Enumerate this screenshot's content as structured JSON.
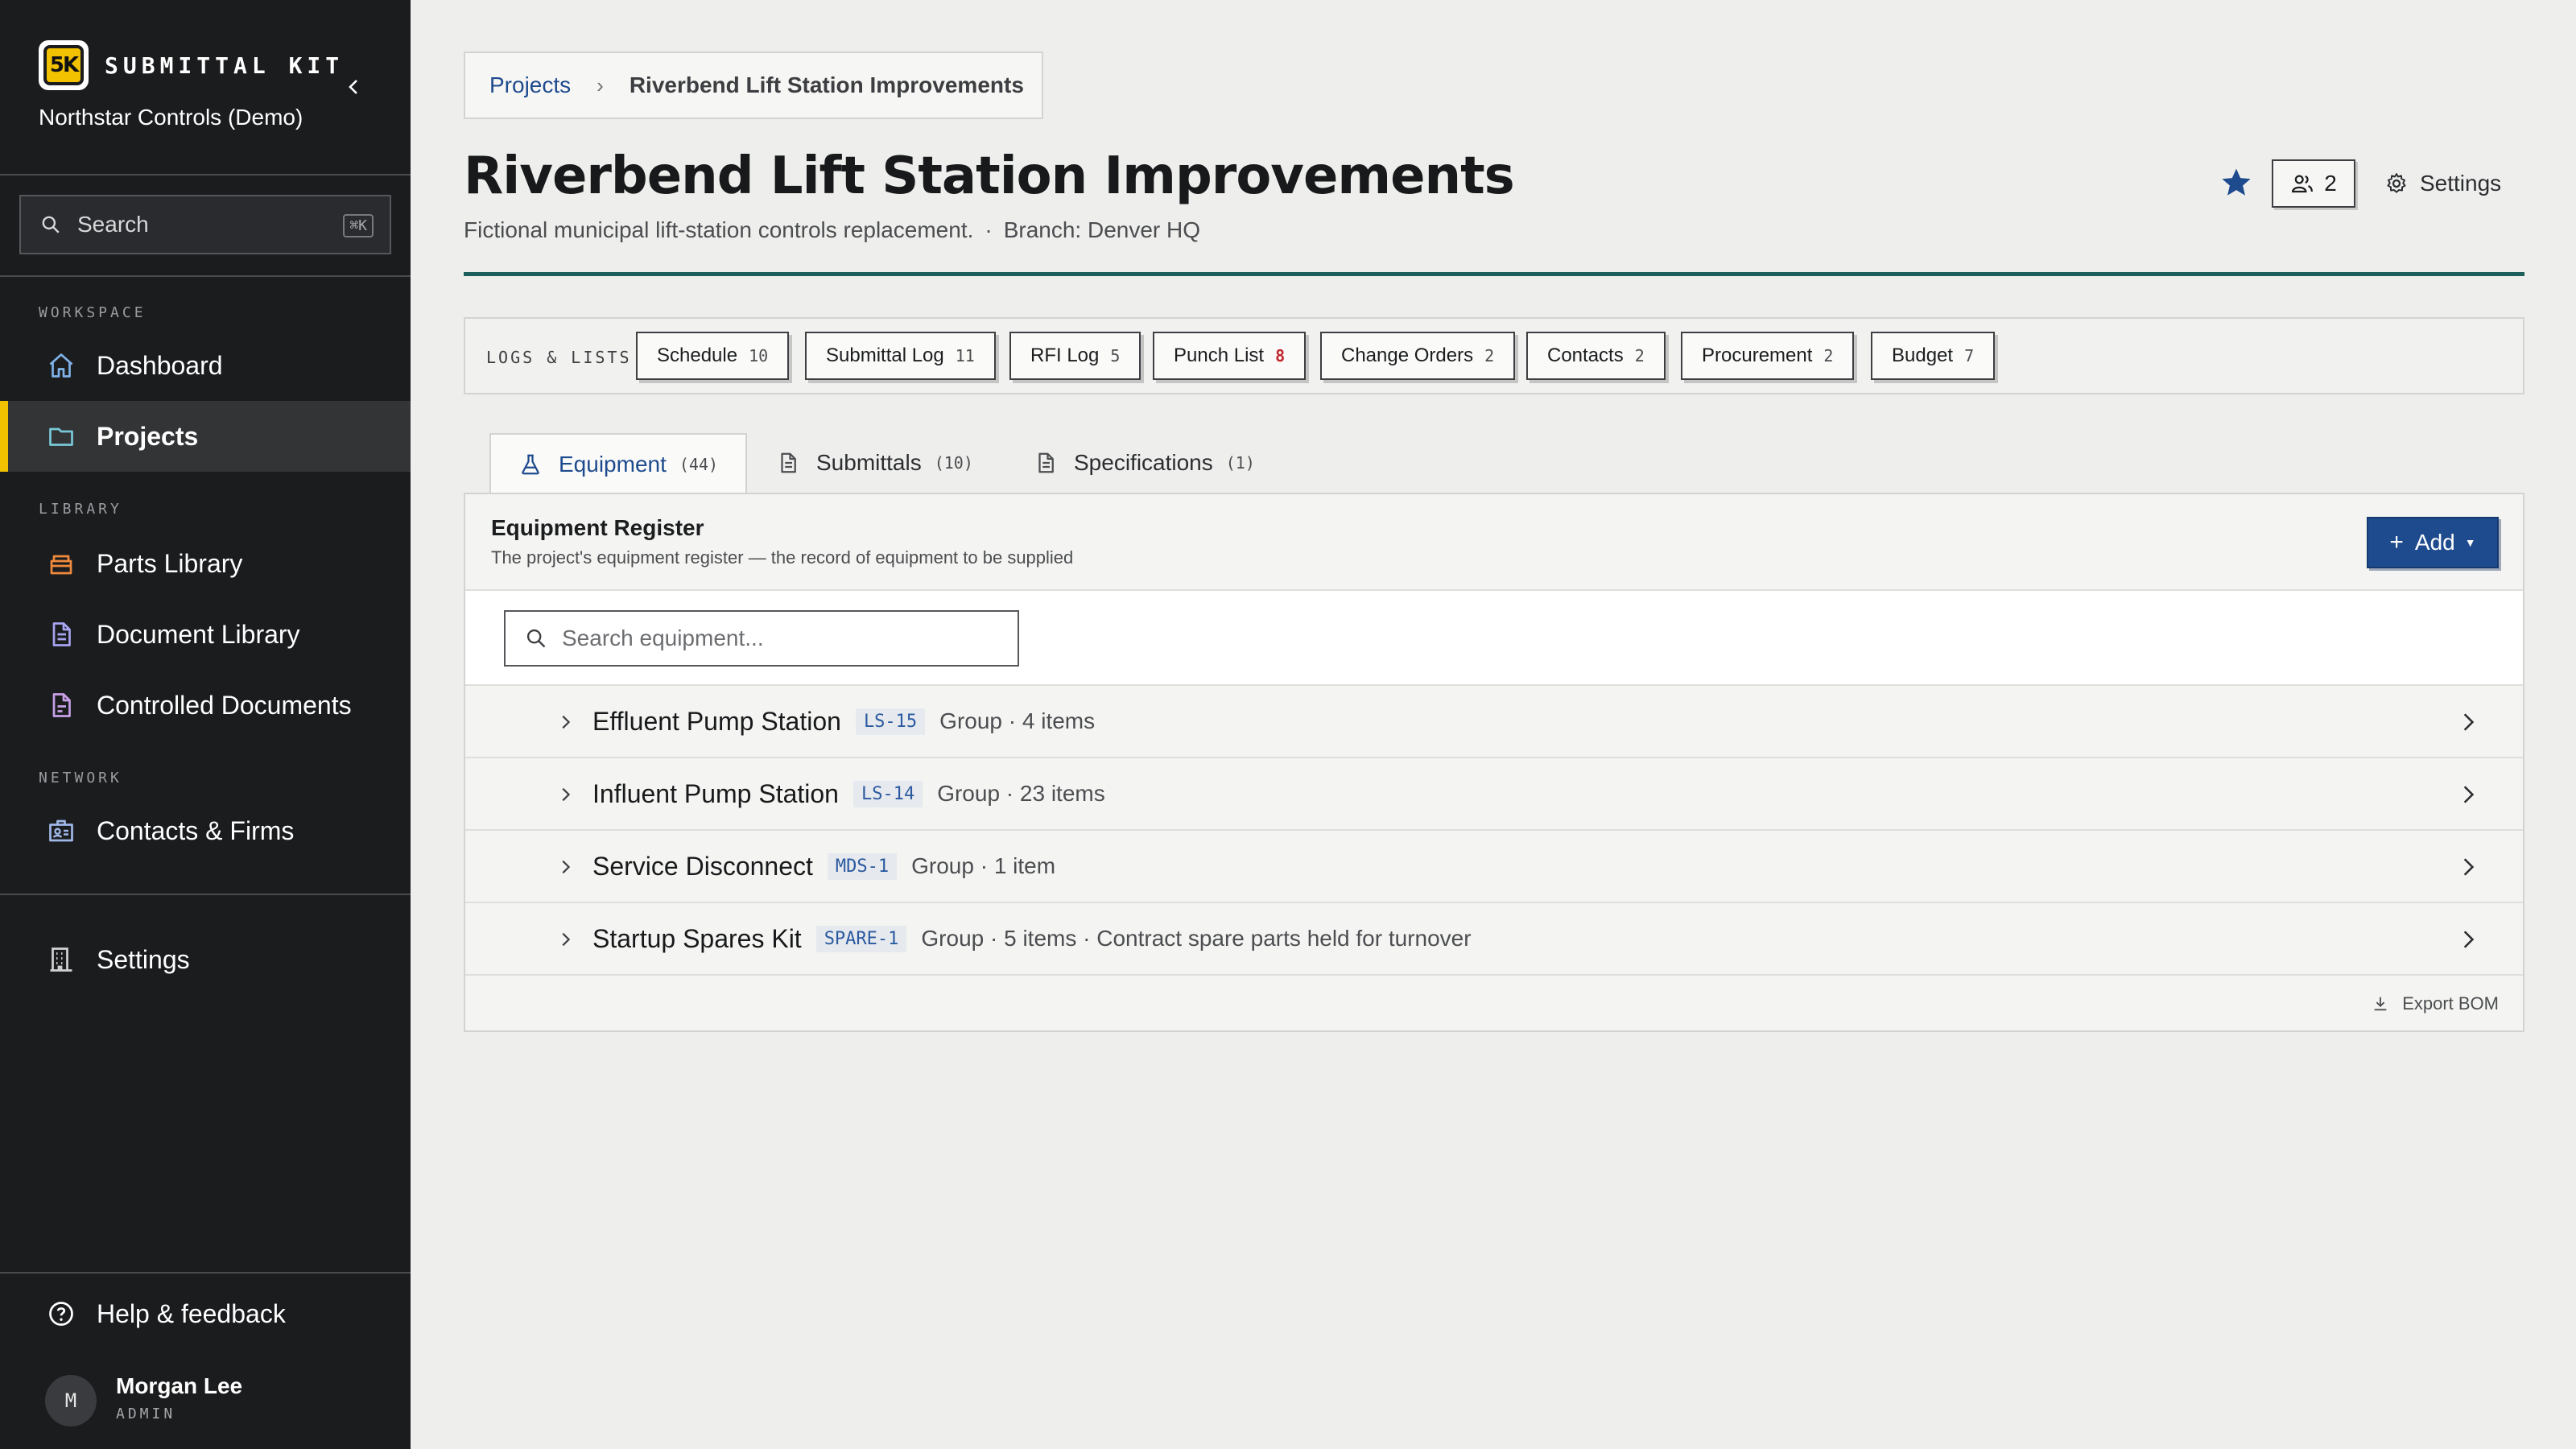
{
  "sidebar": {
    "brand_logo": "5K",
    "brand_name": "SUBMITTAL KIT",
    "org_name": "Northstar Controls (Demo)",
    "search_label": "Search",
    "search_shortcut": "⌘K",
    "section_workspace": "WORKSPACE",
    "section_library": "LIBRARY",
    "section_network": "NETWORK",
    "nav": {
      "dashboard": "Dashboard",
      "projects": "Projects",
      "parts_library": "Parts Library",
      "document_library": "Document Library",
      "controlled_documents": "Controlled Documents",
      "contacts_firms": "Contacts & Firms",
      "settings": "Settings",
      "help": "Help & feedback"
    },
    "user": {
      "initial": "M",
      "name": "Morgan Lee",
      "role": "ADMIN"
    },
    "accent_color": "#f2c200"
  },
  "breadcrumb": {
    "root": "Projects",
    "current": "Riverbend Lift Station Improvements"
  },
  "header": {
    "title": "Riverbend Lift Station Improvements",
    "description": "Fictional municipal lift-station controls replacement.",
    "separator": "·",
    "branch": "Branch: Denver HQ",
    "members_count": "2",
    "settings_label": "Settings",
    "starred": true
  },
  "logs": {
    "label": "LOGS & LISTS",
    "items": [
      {
        "label": "Schedule",
        "count": "10",
        "alert": false
      },
      {
        "label": "Submittal Log",
        "count": "11",
        "alert": false
      },
      {
        "label": "RFI Log",
        "count": "5",
        "alert": false
      },
      {
        "label": "Punch List",
        "count": "8",
        "alert": true
      },
      {
        "label": "Change Orders",
        "count": "2",
        "alert": false
      },
      {
        "label": "Contacts",
        "count": "2",
        "alert": false
      },
      {
        "label": "Procurement",
        "count": "2",
        "alert": false
      },
      {
        "label": "Budget",
        "count": "7",
        "alert": false
      }
    ]
  },
  "tabs": [
    {
      "label": "Equipment",
      "count": "(44)",
      "icon": "flask-icon",
      "active": true
    },
    {
      "label": "Submittals",
      "count": "(10)",
      "icon": "document-icon",
      "active": false
    },
    {
      "label": "Specifications",
      "count": "(1)",
      "icon": "document-icon",
      "active": false
    }
  ],
  "register": {
    "title": "Equipment Register",
    "description": "The project's equipment register — the record of equipment to be supplied",
    "add_label": "Add",
    "search_placeholder": "Search equipment...",
    "rows": [
      {
        "name": "Effluent Pump Station",
        "tag": "LS-15",
        "meta": "Group · 4 items"
      },
      {
        "name": "Influent Pump Station",
        "tag": "LS-14",
        "meta": "Group · 23 items"
      },
      {
        "name": "Service Disconnect",
        "tag": "MDS-1",
        "meta": "Group · 1 item"
      },
      {
        "name": "Startup Spares Kit",
        "tag": "SPARE-1",
        "meta": "Group · 5 items · Contract spare parts held for turnover"
      }
    ],
    "export_label": "Export BOM"
  },
  "colors": {
    "primary": "#1e4b8e",
    "rule": "#1d5f5a",
    "alert": "#c0272d"
  }
}
